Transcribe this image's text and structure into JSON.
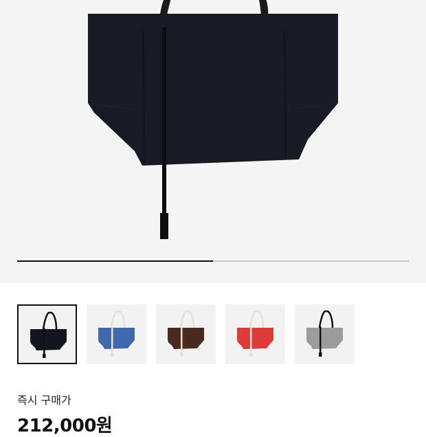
{
  "gallery": {
    "progress_fraction": 0.5,
    "thumbnails": [
      {
        "color": "#14161d",
        "strap": "#111111",
        "selected": true
      },
      {
        "color": "#3f68ad",
        "strap": "#e9dfd2",
        "selected": false
      },
      {
        "color": "#4a2a1e",
        "strap": "#e9dfd2",
        "selected": false
      },
      {
        "color": "#dd3a38",
        "strap": "#e9dfd2",
        "selected": false
      },
      {
        "color": "#9c9c9c",
        "strap": "#111111",
        "selected": false
      }
    ]
  },
  "purchase": {
    "label": "즉시 구매가",
    "price": "212,000원"
  }
}
